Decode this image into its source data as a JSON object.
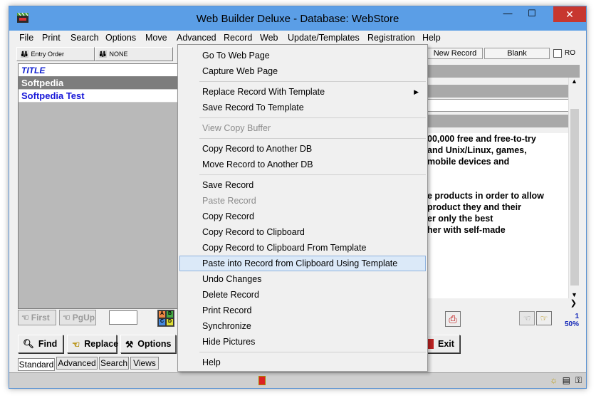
{
  "window": {
    "title": "Web Builder Deluxe - Database: WebStore",
    "minimize": "—",
    "maximize": "☐",
    "close": "✕"
  },
  "menubar": [
    "File",
    "Print",
    "Search",
    "Options",
    "Move",
    "Advanced",
    "Record",
    "Web",
    "Update/Templates",
    "Registration",
    "Help"
  ],
  "toolbar": {
    "sort_label": "Entry Order",
    "filter_label": "NONE",
    "new_record": "New Record",
    "blank": "Blank",
    "ro_label": "RO"
  },
  "list": {
    "header": "TITLE",
    "rows": [
      "Softpedia",
      "Softpedia Test"
    ]
  },
  "nav": {
    "first": "First",
    "pgup": "PgUp",
    "abc_letters": [
      "A",
      "B",
      "C",
      "D"
    ]
  },
  "actions": {
    "find": "Find",
    "replace": "Replace",
    "options": "Options",
    "exit": "Exit"
  },
  "tabs": [
    "Standard",
    "Advanced",
    "Search",
    "Views"
  ],
  "record_text": [
    "00,000 free and free-to-try",
    "and Unix/Linux, games,",
    "mobile devices and",
    "",
    "",
    "e products in order to allow",
    "product they and their",
    "er only the best",
    "her with self-made"
  ],
  "zoom": {
    "page": "1",
    "percent": "50%"
  },
  "context_menu": {
    "items": [
      {
        "label": "Go To Web Page",
        "disabled": false
      },
      {
        "label": "Capture Web Page",
        "disabled": false
      },
      {
        "label": "Replace Record With Template",
        "disabled": false,
        "submenu": true
      },
      {
        "label": "Save Record To Template",
        "disabled": false
      },
      {
        "label": "View Copy Buffer",
        "disabled": true
      },
      {
        "label": "Copy Record to Another DB",
        "disabled": false
      },
      {
        "label": "Move Record to Another DB",
        "disabled": false
      },
      {
        "label": "Save Record",
        "disabled": false
      },
      {
        "label": "Paste Record",
        "disabled": true
      },
      {
        "label": "Copy Record",
        "disabled": false
      },
      {
        "label": "Copy Record to Clipboard",
        "disabled": false
      },
      {
        "label": "Copy Record to Clipboard From Template",
        "disabled": false
      },
      {
        "label": "Paste into Record from Clipboard Using Template",
        "disabled": false,
        "highlighted": true
      },
      {
        "label": "Undo Changes",
        "disabled": false
      },
      {
        "label": "Delete Record",
        "disabled": false
      },
      {
        "label": "Print Record",
        "disabled": false
      },
      {
        "label": "Synchronize",
        "disabled": false
      },
      {
        "label": "Hide Pictures",
        "disabled": false
      },
      {
        "label": "Help",
        "disabled": false
      }
    ],
    "submenu_arrow": "▶"
  },
  "colors": {
    "titlebar": "#5b9ee6",
    "list_selected": "#7d7d7d",
    "list_link": "#1818d8",
    "menu_highlight": "#dbe9f8",
    "close_button": "#c7372f"
  }
}
